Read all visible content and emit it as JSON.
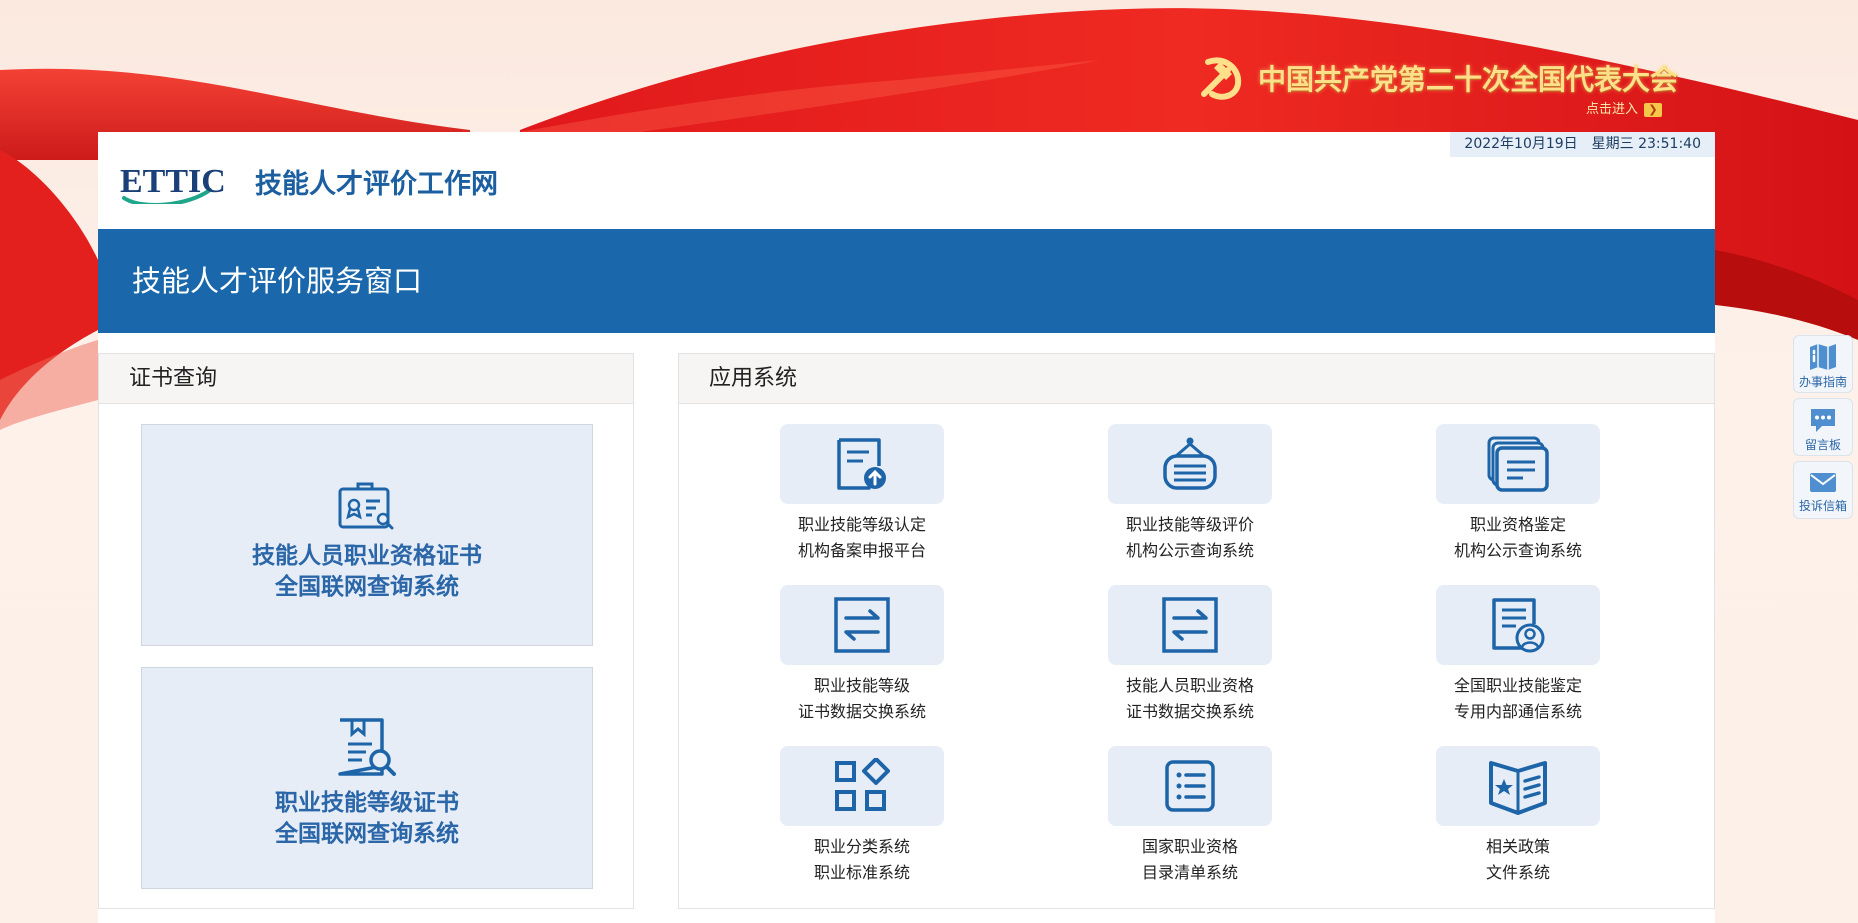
{
  "banner": {
    "title": "中国共产党第二十次全国代表大会",
    "enter_label": "点击进入"
  },
  "header": {
    "logo_text": "ETTIC",
    "site_title": "技能人才评价工作网",
    "date": "2022年10月19日",
    "weekday_time": "星期三 23:51:40"
  },
  "service_bar": {
    "title": "技能人才评价服务窗口"
  },
  "certificate_panel": {
    "title": "证书查询",
    "cards": [
      {
        "line1": "技能人员职业资格证书",
        "line2": "全国联网查询系统",
        "icon": "certificate-search-icon"
      },
      {
        "line1": "职业技能等级证书",
        "line2": "全国联网查询系统",
        "icon": "document-search-icon"
      }
    ]
  },
  "apps_panel": {
    "title": "应用系统",
    "items": [
      {
        "line1": "职业技能等级认定",
        "line2": "机构备案申报平台",
        "icon": "document-upload-icon"
      },
      {
        "line1": "职业技能等级评价",
        "line2": "机构公示查询系统",
        "icon": "notice-board-icon"
      },
      {
        "line1": "职业资格鉴定",
        "line2": "机构公示查询系统",
        "icon": "stacked-documents-icon"
      },
      {
        "line1": "职业技能等级",
        "line2": "证书数据交换系统",
        "icon": "exchange-icon"
      },
      {
        "line1": "技能人员职业资格",
        "line2": "证书数据交换系统",
        "icon": "exchange-icon"
      },
      {
        "line1": "全国职业技能鉴定",
        "line2": "专用内部通信系统",
        "icon": "document-user-icon"
      },
      {
        "line1": "职业分类系统",
        "line2": "职业标准系统",
        "icon": "category-grid-icon"
      },
      {
        "line1": "国家职业资格",
        "line2": "目录清单系统",
        "icon": "list-icon"
      },
      {
        "line1": "相关政策",
        "line2": "文件系统",
        "icon": "policy-book-icon"
      }
    ]
  },
  "side_tools": [
    {
      "label": "办事指南",
      "icon": "guide-map-icon"
    },
    {
      "label": "留言板",
      "icon": "message-bubble-icon"
    },
    {
      "label": "投诉信箱",
      "icon": "mail-icon"
    }
  ],
  "colors": {
    "primary_blue": "#1a68ab",
    "title_blue": "#1b5fa0",
    "tile_bg": "#e6edf6",
    "banner_red": "#d8161a",
    "banner_gold": "#ffe08a"
  }
}
